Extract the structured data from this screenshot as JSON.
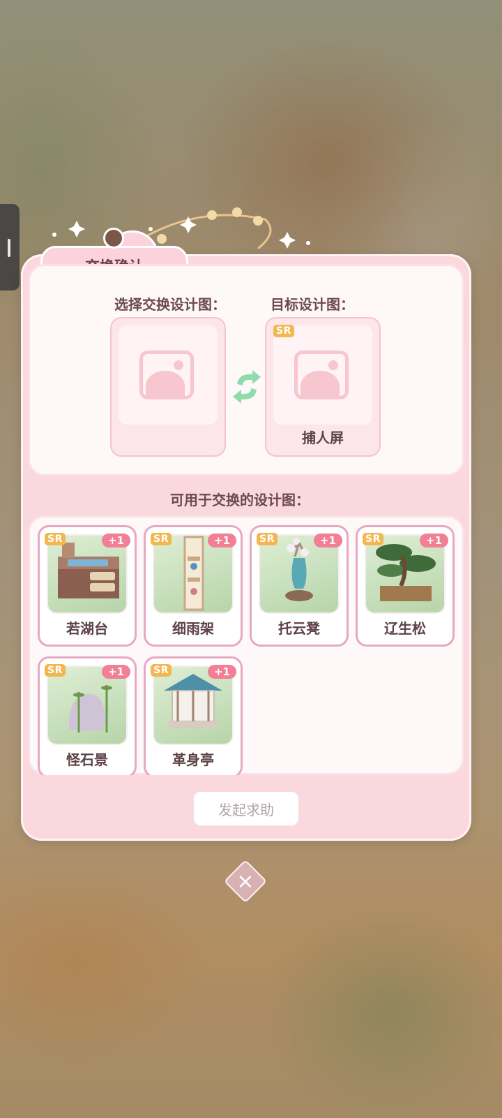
{
  "dialog": {
    "title": "交换确认",
    "select_label": "选择交换设计图：",
    "target_label": "目标设计图：",
    "target_item": {
      "rarity": "SR",
      "name": "捕人屏"
    },
    "available_label": "可用于交换的设计图：",
    "help_button": "发起求助",
    "close_icon": "close-icon"
  },
  "items": [
    {
      "rarity": "SR",
      "count": "+1",
      "name": "若湖台"
    },
    {
      "rarity": "SR",
      "count": "+1",
      "name": "细雨架"
    },
    {
      "rarity": "SR",
      "count": "+1",
      "name": "托云凳"
    },
    {
      "rarity": "SR",
      "count": "+1",
      "name": "辽生松"
    },
    {
      "rarity": "SR",
      "count": "+1",
      "name": "怪石景"
    },
    {
      "rarity": "SR",
      "count": "+1",
      "name": "革身亭"
    }
  ],
  "colors": {
    "accent": "#f27f95",
    "panel": "#fbd7de",
    "rarity": "#f3b651"
  }
}
